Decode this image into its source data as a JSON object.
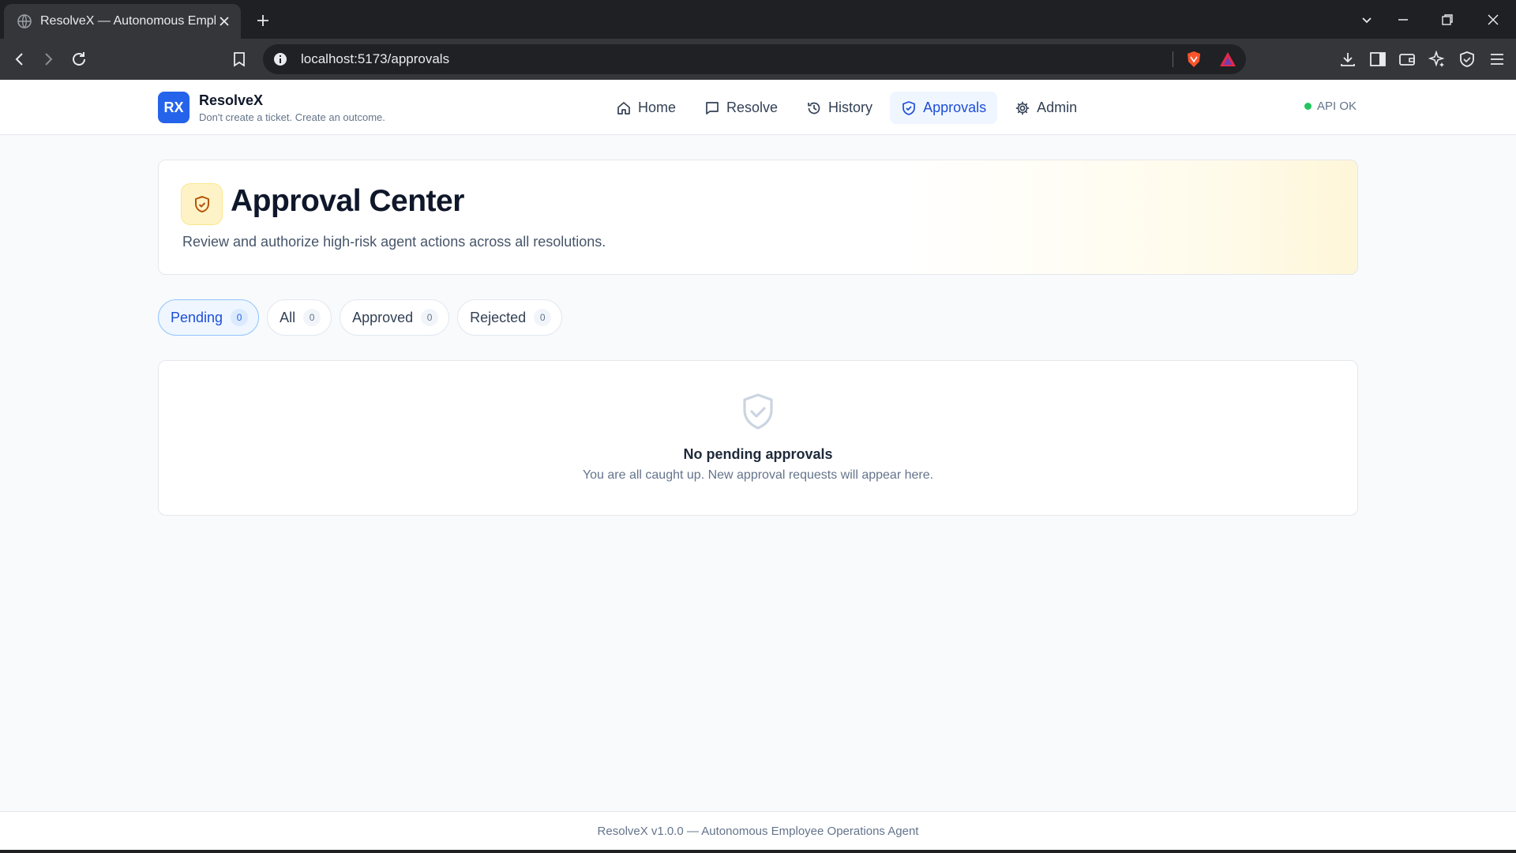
{
  "browser": {
    "tab_title": "ResolveX — Autonomous Employee Operations Agent",
    "url": "localhost:5173/approvals"
  },
  "app": {
    "logo_text": "RX",
    "name": "ResolveX",
    "tagline": "Don't create a ticket. Create an outcome.",
    "nav": [
      {
        "label": "Home",
        "icon": "home-icon"
      },
      {
        "label": "Resolve",
        "icon": "chat-icon"
      },
      {
        "label": "History",
        "icon": "history-icon"
      },
      {
        "label": "Approvals",
        "icon": "shield-check-icon",
        "active": true
      },
      {
        "label": "Admin",
        "icon": "gear-icon"
      }
    ],
    "api_status": "API OK"
  },
  "hero": {
    "title": "Approval Center",
    "subtitle": "Review and authorize high-risk agent actions across all resolutions."
  },
  "filters": [
    {
      "label": "Pending",
      "count": "0",
      "active": true
    },
    {
      "label": "All",
      "count": "0"
    },
    {
      "label": "Approved",
      "count": "0"
    },
    {
      "label": "Rejected",
      "count": "0"
    }
  ],
  "empty_state": {
    "title": "No pending approvals",
    "subtitle": "You are all caught up. New approval requests will appear here."
  },
  "footer": "ResolveX v1.0.0 — Autonomous Employee Operations Agent",
  "colors": {
    "accent": "#2563eb",
    "accent_light": "#eff6ff",
    "status_ok": "#22c55e",
    "warning_bg": "#fef3c7",
    "warning_icon": "#b45309"
  }
}
